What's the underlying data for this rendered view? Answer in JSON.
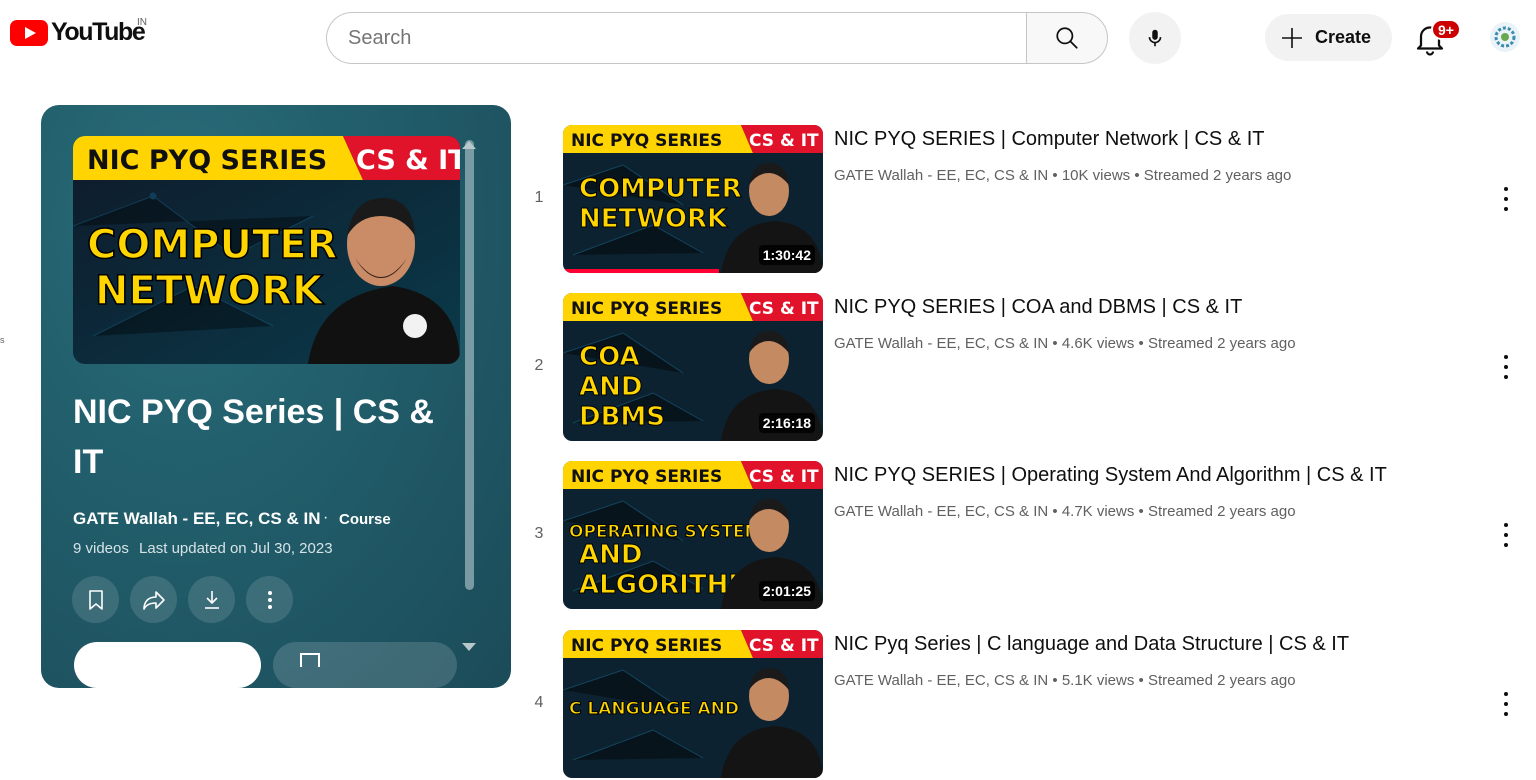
{
  "header": {
    "logo_text": "YouTube",
    "region": "IN",
    "search_placeholder": "Search",
    "create_label": "Create",
    "notification_count": "9+",
    "icons": [
      "youtube-logo-icon",
      "search-icon",
      "microphone-icon",
      "plus-icon",
      "bell-icon",
      "avatar"
    ]
  },
  "edge_text": "s",
  "playlist": {
    "thumbnail": {
      "banner_left": "NIC PYQ SERIES",
      "banner_right": "CS & IT",
      "subject_line1": "COMPUTER",
      "subject_line2": "NETWORK"
    },
    "title": "NIC PYQ Series | CS & IT",
    "owner": "GATE Wallah - EE, EC, CS & IN",
    "separator": "·",
    "type": "Course",
    "video_count": "9 videos",
    "last_updated": "Last updated on Jul 30, 2023",
    "actions": [
      "save-icon",
      "share-icon",
      "download-icon",
      "more-icon"
    ]
  },
  "videos": [
    {
      "index": "1",
      "title": "NIC PYQ SERIES | Computer Network | CS & IT",
      "channel": "GATE Wallah - EE, EC, CS & IN",
      "views": "10K views",
      "streamed": "Streamed 2 years ago",
      "duration": "1:30:42",
      "thumb": {
        "banner_left": "NIC PYQ SERIES",
        "banner_right": "CS & IT",
        "lines": [
          "COMPUTER",
          "NETWORK"
        ]
      },
      "watched_fraction": 0.6
    },
    {
      "index": "2",
      "title": "NIC PYQ SERIES | COA and DBMS | CS & IT",
      "channel": "GATE Wallah - EE, EC, CS & IN",
      "views": "4.6K views",
      "streamed": "Streamed 2 years ago",
      "duration": "2:16:18",
      "thumb": {
        "banner_left": "NIC PYQ SERIES",
        "banner_right": "CS & IT",
        "lines": [
          "COA",
          "AND",
          "DBMS"
        ]
      },
      "watched_fraction": 0
    },
    {
      "index": "3",
      "title": "NIC PYQ SERIES | Operating System And Algorithm | CS & IT",
      "channel": "GATE Wallah - EE, EC, CS & IN",
      "views": "4.7K views",
      "streamed": "Streamed 2 years ago",
      "duration": "2:01:25",
      "thumb": {
        "banner_left": "NIC PYQ SERIES",
        "banner_right": "CS & IT",
        "lines": [
          "OPERATING SYSTEM",
          "AND",
          "ALGORITHM"
        ]
      },
      "watched_fraction": 0
    },
    {
      "index": "4",
      "title": "NIC Pyq Series | C language and Data Structure | CS & IT",
      "channel": "GATE Wallah - EE, EC, CS & IN",
      "views": "5.1K views",
      "streamed": "Streamed 2 years ago",
      "duration": "",
      "thumb": {
        "banner_left": "NIC PYQ SERIES",
        "banner_right": "CS & IT",
        "lines": [
          "C LANGUAGE AND"
        ]
      },
      "watched_fraction": 0
    }
  ],
  "colors": {
    "brand_red": "#ff0000",
    "thumb_banner_yellow": "#ffd400",
    "thumb_banner_red": "#e0132a",
    "thumb_text_yellow": "#ffd500",
    "panel_teal": "#22606d"
  }
}
